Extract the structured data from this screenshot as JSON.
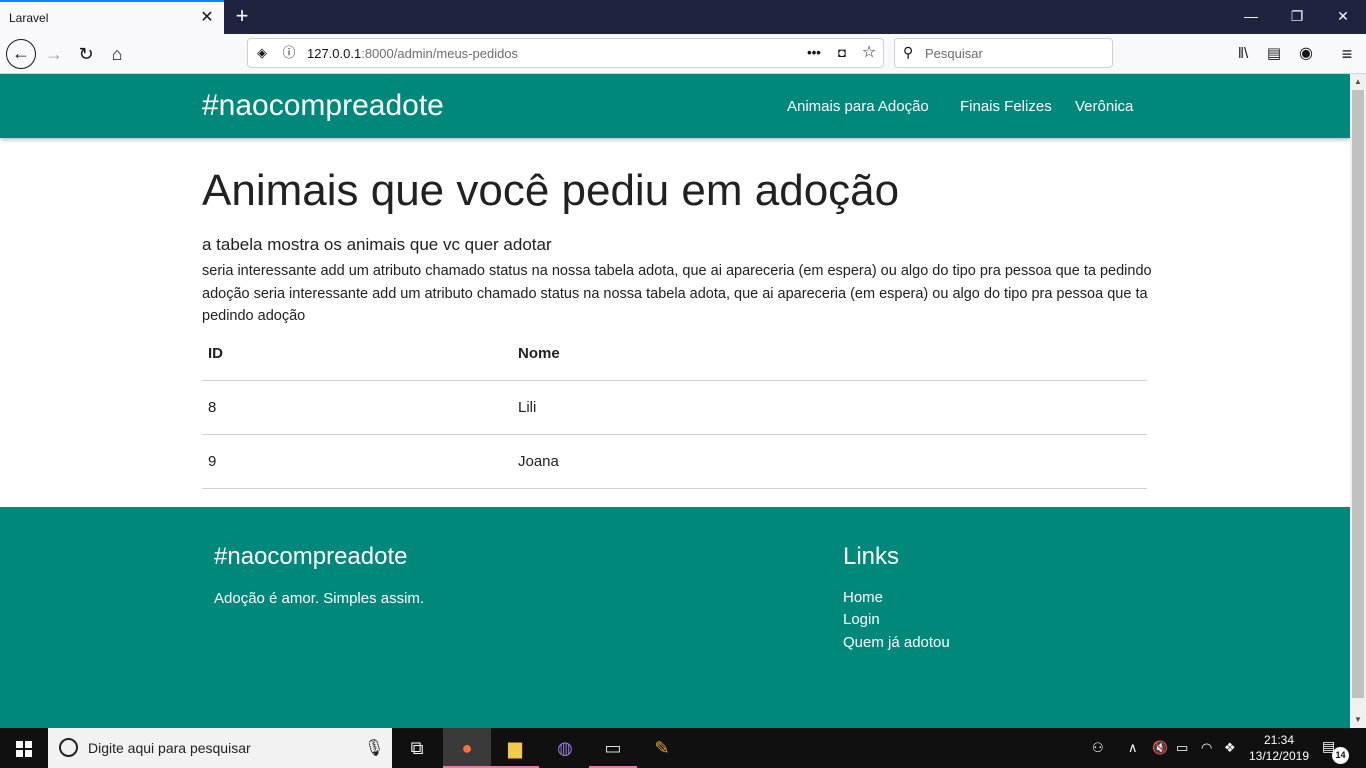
{
  "browser": {
    "tab_title": "Laravel",
    "tab_close": "✕",
    "new_tab": "+",
    "url_host": "127.0.0.1",
    "url_rest": ":8000/admin/meus-pedidos",
    "search_placeholder": "Pesquisar",
    "window_controls": {
      "minimize": "—",
      "restore": "❐",
      "close": "✕"
    }
  },
  "site": {
    "brand": "#naocompreadote",
    "menu": [
      "Animais para Adoção",
      "Finais Felizes",
      "Verônica"
    ]
  },
  "main": {
    "title": "Animais que você pediu em adoção",
    "subtitle": "a tabela mostra os animais que vc quer adotar",
    "description": "seria interessante add um atributo chamado status na nossa tabela adota, que ai apareceria (em espera) ou algo do tipo pra pessoa que ta pedindo adoção seria interessante add um atributo chamado status na nossa tabela adota, que ai apareceria (em espera) ou algo do tipo pra pessoa que ta pedindo adoção",
    "table": {
      "headers": [
        "ID",
        "Nome"
      ],
      "rows": [
        [
          "8",
          "Lili"
        ],
        [
          "9",
          "Joana"
        ]
      ]
    }
  },
  "footer": {
    "brand": "#naocompreadote",
    "tagline": "Adoção é amor. Simples assim.",
    "links_title": "Links",
    "links": [
      "Home",
      "Login",
      "Quem já adotou"
    ]
  },
  "taskbar": {
    "search_placeholder": "Digite aqui para pesquisar",
    "time": "21:34",
    "date": "13/12/2019",
    "notification_count": "14"
  },
  "colors": {
    "brand": "#00897b",
    "titlebar": "#202340",
    "accent": "#0a84ff"
  }
}
